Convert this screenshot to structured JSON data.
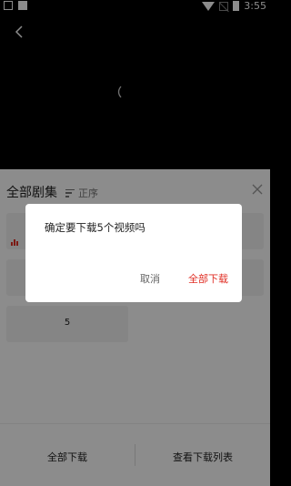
{
  "status_bar": {
    "time": "3:55",
    "icons": [
      "photo-icon",
      "text-a-icon",
      "wifi-icon",
      "no-signal-icon",
      "battery-charging-icon"
    ]
  },
  "player": {
    "icons": [
      "back-arrow-icon",
      "loading-spinner-icon"
    ]
  },
  "sheet": {
    "title": "全部剧集",
    "sort_label": "正序",
    "episodes": [
      {
        "label": "",
        "playing": true
      },
      {
        "label": ""
      },
      {
        "label": ""
      },
      {
        "label": ""
      },
      {
        "label": "5"
      }
    ],
    "bottom": {
      "download_all": "全部下载",
      "view_list": "查看下载列表"
    }
  },
  "dialog": {
    "message": "确定要下载5个视频吗",
    "cancel": "取消",
    "confirm": "全部下载"
  },
  "colors": {
    "accent": "#e02e24",
    "overlay": "rgba(0,0,0,0.45)"
  }
}
